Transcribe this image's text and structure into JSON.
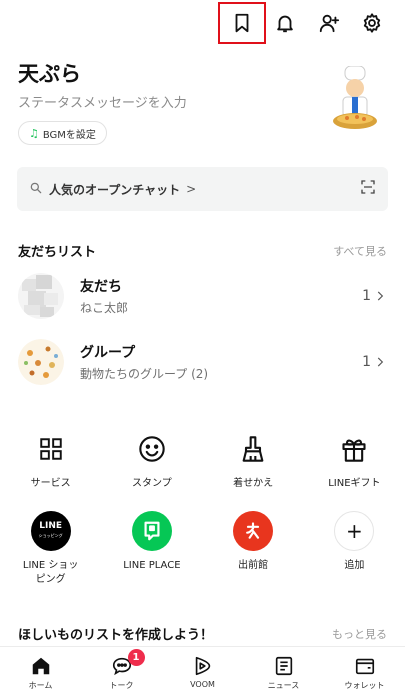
{
  "profile": {
    "name": "天ぷら",
    "status_placeholder": "ステータスメッセージを入力",
    "bgm_label": "BGMを設定"
  },
  "search": {
    "label": "人気のオープンチャット",
    "chevron": ">"
  },
  "friends_section": {
    "title": "友だちリスト",
    "see_all": "すべて見る",
    "rows": [
      {
        "title": "友だち",
        "subtitle": "ねこ太郎",
        "count": "1"
      },
      {
        "title": "グループ",
        "subtitle": "動物たちのグループ (2)",
        "count": "1"
      }
    ]
  },
  "services": [
    {
      "label": "サービス",
      "icon": "grid-icon"
    },
    {
      "label": "スタンプ",
      "icon": "smile-icon"
    },
    {
      "label": "着せかえ",
      "icon": "brush-icon"
    },
    {
      "label": "LINEギフト",
      "icon": "gift-icon"
    }
  ],
  "apps": [
    {
      "label": "LINE ショッ\nピング",
      "icon": "line-shopping-icon",
      "icon_text": "LINE",
      "icon_sub": "ショッピング",
      "color": "#000000"
    },
    {
      "label": "LINE PLACE",
      "icon": "line-place-icon",
      "color": "#06c755"
    },
    {
      "label": "出前館",
      "icon": "demaecan-icon",
      "color": "#e8351e"
    },
    {
      "label": "追加",
      "icon": "plus-icon",
      "icon_text": "+"
    }
  ],
  "wishlist": {
    "title": "ほしいものリストを作成しよう！",
    "more": "もっと見る"
  },
  "bottom_nav": [
    {
      "label": "ホーム",
      "icon": "home-icon"
    },
    {
      "label": "トーク",
      "icon": "chat-icon",
      "badge": "1"
    },
    {
      "label": "VOOM",
      "icon": "voom-icon"
    },
    {
      "label": "ニュース",
      "icon": "news-icon"
    },
    {
      "label": "ウォレット",
      "icon": "wallet-icon"
    }
  ],
  "colors": {
    "highlight": "#e0101a",
    "accent_green": "#06c755",
    "badge_red": "#ef2d4c"
  }
}
